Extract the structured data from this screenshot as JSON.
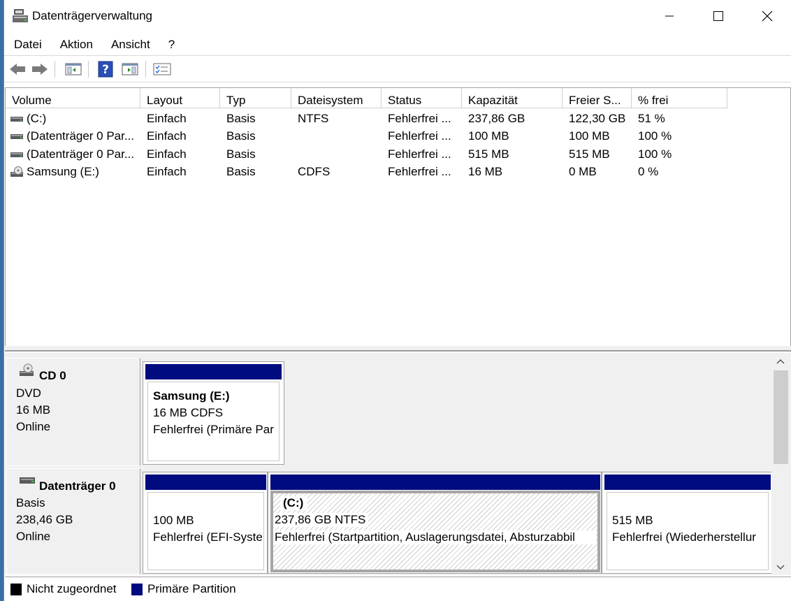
{
  "window": {
    "title": "Datenträgerverwaltung"
  },
  "menu": [
    "Datei",
    "Aktion",
    "Ansicht",
    "?"
  ],
  "toolbar": {
    "buttons": [
      "back-arrow-icon",
      "forward-arrow-icon",
      "console-tree-icon",
      "help-icon",
      "action-pane-icon",
      "properties-icon"
    ]
  },
  "volumes": {
    "columns": [
      "Volume",
      "Layout",
      "Typ",
      "Dateisystem",
      "Status",
      "Kapazität",
      "Freier S...",
      "% frei"
    ],
    "rows": [
      {
        "volume": " (C:)",
        "layout": "Einfach",
        "typ": "Basis",
        "fs": "NTFS",
        "status": "Fehlerfrei ...",
        "kap": "237,86 GB",
        "frei": "122,30 GB",
        "pct": "51 %",
        "icon": "drive-icon"
      },
      {
        "volume": "(Datenträger 0 Par...",
        "layout": "Einfach",
        "typ": "Basis",
        "fs": "",
        "status": "Fehlerfrei ...",
        "kap": "100 MB",
        "frei": "100 MB",
        "pct": "100 %",
        "icon": "drive-icon"
      },
      {
        "volume": "(Datenträger 0 Par...",
        "layout": "Einfach",
        "typ": "Basis",
        "fs": "",
        "status": "Fehlerfrei ...",
        "kap": "515 MB",
        "frei": "515 MB",
        "pct": "100 %",
        "icon": "drive-icon"
      },
      {
        "volume": "Samsung (E:)",
        "layout": "Einfach",
        "typ": "Basis",
        "fs": "CDFS",
        "status": "Fehlerfrei ...",
        "kap": "16 MB",
        "frei": "0 MB",
        "pct": "0 %",
        "icon": "cd-drive-icon"
      }
    ]
  },
  "disks": {
    "cd0": {
      "title": "CD 0",
      "type": "DVD",
      "size": "16 MB",
      "state": "Online",
      "partition": {
        "name": "Samsung  (E:)",
        "detail": "16 MB CDFS",
        "status": "Fehlerfrei (Primäre Par"
      }
    },
    "disk0": {
      "title": "Datenträger 0",
      "type": "Basis",
      "size": "238,46 GB",
      "state": "Online",
      "partitions": [
        {
          "name": "",
          "detail": "100 MB",
          "status": "Fehlerfrei (EFI-Syste"
        },
        {
          "name": "(C:)",
          "detail": "237,86 GB NTFS",
          "status": "Fehlerfrei (Startpartition, Auslagerungsdatei, Absturzabbil"
        },
        {
          "name": "",
          "detail": "515 MB",
          "status": "Fehlerfrei (Wiederherstellur"
        }
      ]
    }
  },
  "legend": {
    "unallocated": "Nicht zugeordnet",
    "primary": "Primäre Partition"
  },
  "colors": {
    "partition_header": "#000b80",
    "unallocated": "#000000"
  }
}
